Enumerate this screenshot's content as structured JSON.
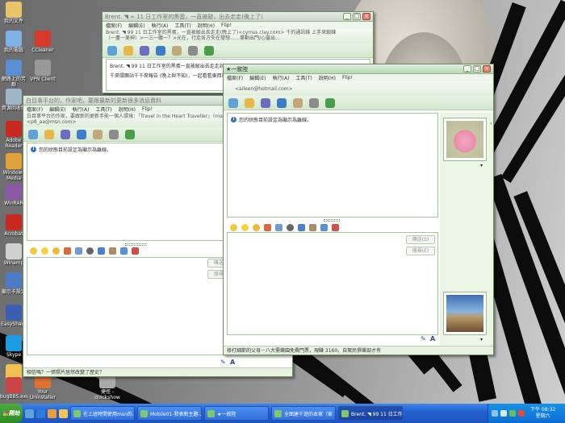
{
  "desktop": {
    "icons": [
      {
        "label": "我的文件",
        "color": "#e9c56a"
      },
      {
        "label": "我的電腦",
        "color": "#7fb0e6"
      },
      {
        "label": "CCleaner",
        "color": "#d73a2b"
      },
      {
        "label": "網路上的芳鄰",
        "color": "#5a8fd6"
      },
      {
        "label": "VPN Client",
        "color": "#999999"
      },
      {
        "label": "資源回收筒",
        "color": "#9fb6c9"
      },
      {
        "label": "Adobe Reader",
        "color": "#c8281e"
      },
      {
        "label": "Windows Media",
        "color": "#e2a13b"
      },
      {
        "label": "WinRAR",
        "color": "#8a5aa8"
      },
      {
        "label": "Acrobat",
        "color": "#c8281e"
      },
      {
        "label": "Winamp",
        "color": "#cfcfcf"
      },
      {
        "label": "顯示卡設定",
        "color": "#4c7bc8"
      },
      {
        "label": "EasyShare",
        "color": "#3a5fb0"
      },
      {
        "label": "Skype",
        "color": "#1d9be0"
      },
      {
        "label": "xxx",
        "color": "#f0c050"
      },
      {
        "label": "bugBBS.exe",
        "color": "#cc4444"
      },
      {
        "label": "Your Uninstaller",
        "color": "#e07030"
      },
      {
        "label": "捷徑 - quickshow",
        "color": "#aaaaaa"
      }
    ]
  },
  "windows": {
    "back": {
      "title": "Brent. ◥ ∞ 11 日工作室的黑蛋，一直被敲，出去走走(晚上了)",
      "menu": [
        "檔案(F)",
        "編輯(E)",
        "執行(A)",
        "工具(T)",
        "說明(H)",
        "Flip!"
      ],
      "to_lines": [
        "Brent. ◥ 99 11 日工作室的黑蛋，一直被敲出去走走(晚上了)<cymss.clay.com> 千的通訊錄 上手來鍛鍊",
        "（一盡一美神）>一三一聽一？>光在，行走各方失在發想……事動出門/心靈出…"
      ],
      "convo_line": "Brent. ◥ 99 11 日工作室的黑蛋一直被敲出去走走說：",
      "convo_line2": "千來環團站千千來報告 (晚上與不知)，一起看看東西哦"
    },
    "left": {
      "title": "白目事平台的，作家吧，要跟最新的更新很多消息資料",
      "subtitle": "<p8_aa@msn.com>",
      "menu": [
        "檔案(F)",
        "編輯(E)",
        "執行(A)",
        "工具(T)",
        "說明(H)",
        "Flip!"
      ],
      "to_line": "白目事平台的作家，要跟新的更新手能一個人環境：「Travel in the Heart Traveller」（msn訊息）",
      "status_message": "您的狀態目前設定為顯示為離線。",
      "send_label": "傳送(S)",
      "search_label": "搜尋(E)",
      "bottom_status": "相信嗎？一張照片居然改變了歷史？"
    },
    "front": {
      "title": "★一敘陸",
      "subtitle": "<aileen@hotmail.com>",
      "menu": [
        "檔案(F)",
        "編輯(E)",
        "執行(A)",
        "工具(T)",
        "說明(H)",
        "Flip!"
      ],
      "status_message": "您的狀態目前設定為顯示為離線。",
      "send_label": "傳送(S)",
      "search_label": "搜尋(E)",
      "bottom_status": "移打細節的父母－八大需樂園免費門票，現賺 3160，自駕民俱樂部才有"
    }
  },
  "taskbar": {
    "start_label": "開始",
    "tasks": [
      {
        "label": "在上班時間使用msn的…",
        "active": false
      },
      {
        "label": "Mobile01-發表新主題-…",
        "active": false
      },
      {
        "label": "★一敘陸",
        "active": false
      },
      {
        "label": "全面建千遊的本家（家",
        "active": false
      },
      {
        "label": "Brent. ◥ 99 11 日工作室",
        "active": true
      }
    ],
    "clock_time": "下午 08:32",
    "clock_day": "星期六"
  },
  "colors": {
    "msn_green": "#d3e7cd",
    "taskbar_blue": "#2460d0"
  }
}
